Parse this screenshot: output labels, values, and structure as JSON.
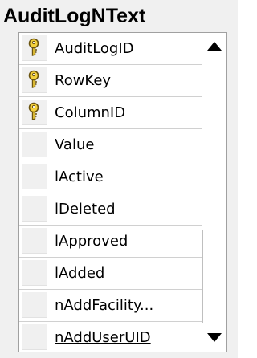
{
  "table": {
    "name": "AuditLogNText",
    "columns": [
      {
        "label": "AuditLogID",
        "primary_key": true
      },
      {
        "label": "RowKey",
        "primary_key": true
      },
      {
        "label": "ColumnID",
        "primary_key": true
      },
      {
        "label": "Value",
        "primary_key": false
      },
      {
        "label": "lActive",
        "primary_key": false
      },
      {
        "label": "lDeleted",
        "primary_key": false
      },
      {
        "label": "lApproved",
        "primary_key": false
      },
      {
        "label": "lAdded",
        "primary_key": false
      },
      {
        "label": "nAddFacility...",
        "primary_key": false
      },
      {
        "label": "nAddUserUID",
        "primary_key": false
      }
    ]
  },
  "icons": {
    "primary_key": "key-icon",
    "scroll_up": "arrow-up-icon",
    "scroll_down": "arrow-down-icon"
  },
  "colors": {
    "panel_background": "#f0f0f0",
    "grid_background": "#ffffff",
    "key_fill": "#f5d23c",
    "key_outline": "#6b5410"
  }
}
